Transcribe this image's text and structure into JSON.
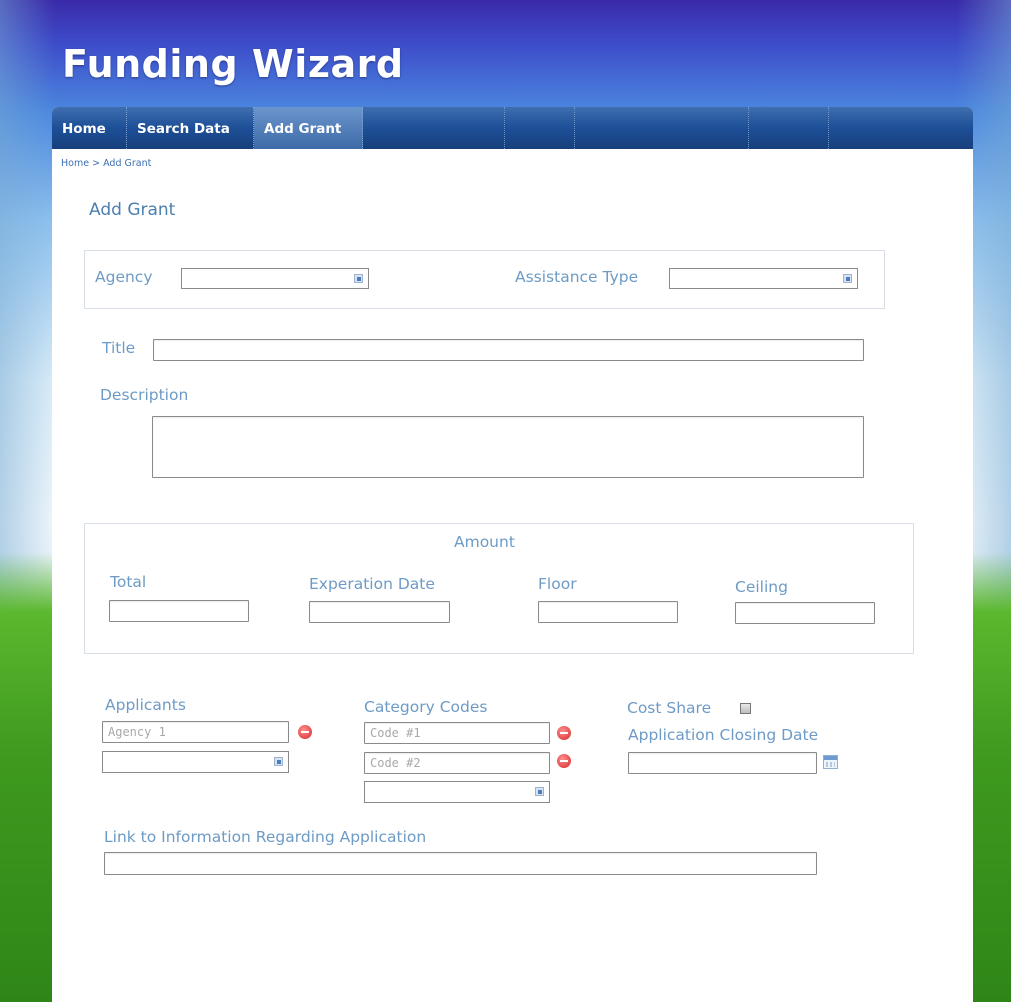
{
  "app": {
    "title": "Funding Wizard"
  },
  "nav": {
    "items": [
      "Home",
      "Search Data",
      "Add Grant"
    ],
    "active_index": 2
  },
  "breadcrumb": {
    "home": "Home",
    "separator": ">",
    "current": "Add Grant"
  },
  "page": {
    "heading": "Add Grant"
  },
  "form": {
    "agency_label": "Agency",
    "assistance_type_label": "Assistance Type",
    "title_label": "Title",
    "description_label": "Description",
    "amount": {
      "legend": "Amount",
      "total_label": "Total",
      "expiration_label": "Experation Date",
      "floor_label": "Floor",
      "ceiling_label": "Ceiling"
    },
    "applicants": {
      "label": "Applicants",
      "items": [
        {
          "value": "Agency 1"
        }
      ]
    },
    "category_codes": {
      "label": "Category Codes",
      "items": [
        {
          "value": "Code #1"
        },
        {
          "value": "Code #2"
        }
      ]
    },
    "cost_share_label": "Cost Share",
    "closing_date_label": "Application Closing Date",
    "link_label": "Link to Information Regarding Application"
  },
  "colors": {
    "nav": "#1d4f97",
    "label": "#6d9bc6",
    "heading": "#4a7fae",
    "remove": "#d62a2a"
  },
  "icons": {
    "remove": "remove-circle-icon",
    "calendar": "calendar-icon",
    "dropdown": "dropdown-arrow-icon"
  }
}
